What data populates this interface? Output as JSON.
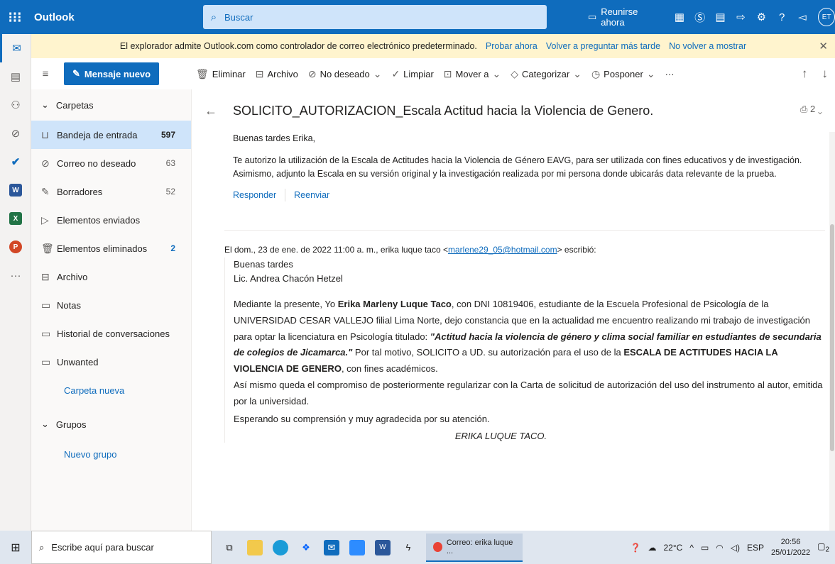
{
  "app": {
    "title": "Outlook"
  },
  "search": {
    "placeholder": "Buscar"
  },
  "topbar": {
    "meet_label": "Reunirse ahora",
    "avatar_initials": "ET"
  },
  "banner": {
    "message": "El explorador admite Outlook.com como controlador de correo electrónico predeterminado.",
    "link1": "Probar ahora",
    "link2": "Volver a preguntar más tarde",
    "link3": "No volver a mostrar"
  },
  "toolbar": {
    "new_mail": "Mensaje nuevo",
    "delete": "Eliminar",
    "archive": "Archivo",
    "junk": "No deseado",
    "sweep": "Limpiar",
    "move": "Mover a",
    "categorize": "Categorizar",
    "snooze": "Posponer",
    "more": "···"
  },
  "folders": {
    "header": "Carpetas",
    "items": [
      {
        "label": "Bandeja de entrada",
        "count": "597"
      },
      {
        "label": "Correo no deseado",
        "count": "63"
      },
      {
        "label": "Borradores",
        "count": "52"
      },
      {
        "label": "Elementos enviados",
        "count": ""
      },
      {
        "label": "Elementos eliminados",
        "count": "2"
      },
      {
        "label": "Archivo",
        "count": ""
      },
      {
        "label": "Notas",
        "count": ""
      },
      {
        "label": "Historial de conversaciones",
        "count": ""
      },
      {
        "label": "Unwanted",
        "count": ""
      }
    ],
    "new_folder": "Carpeta nueva",
    "groups_header": "Grupos",
    "new_group": "Nuevo grupo"
  },
  "message": {
    "subject": "SOLICITO_AUTORIZACION_Escala Actitud hacia la Violencia de Genero.",
    "attachments": "2",
    "greeting": "Buenas tardes Erika,",
    "body": "Te autorizo la utilización de la Escala de Actitudes hacia la Violencia de Género EAVG, para ser utilizada con fines educativos y de investigación. Asimismo, adjunto la Escala en su versión original y la investigación realizada por mi persona donde ubicarás data relevante de la prueba.",
    "reply": "Responder",
    "forward": "Reenviar"
  },
  "quoted": {
    "header_prefix": "El dom., 23 de ene. de 2022 11:00 a. m., erika luque taco <",
    "email": "marlene29_05@hotmail.com",
    "header_suffix": "> escribió:",
    "line1": "Buenas tardes",
    "line2": "Lic. Andrea Chacón Hetzel",
    "p1_a": "Mediante la presente, Yo ",
    "p1_name": "Erika Marleny Luque Taco",
    "p1_b": ", con DNI 10819406, estudiante de la Escuela Profesional de Psicología de la UNIVERSIDAD CESAR VALLEJO filial Lima Norte, dejo constancia que en la actualidad me encuentro realizando mi trabajo de investigación para optar la licenciatura en Psicología titulado: ",
    "p1_title": "\"Actitud hacia la violencia de género y clima social familiar en estudiantes de secundaria de colegios de Jicamarca.\"",
    "p1_c": " Por tal motivo, SOLICITO a UD. su autorización para el uso de la ",
    "p1_scale": "ESCALA DE ACTITUDES HACIA LA VIOLENCIA DE GENERO",
    "p1_d": ", con fines académicos.",
    "p2": "Así mismo queda el compromiso de posteriormente regularizar con la Carta de solicitud de autorización del uso del instrumento al autor, emitida por la universidad.",
    "p3": "Esperando su comprensión y muy agradecida por su atención.",
    "signature": "ERIKA LUQUE TACO."
  },
  "taskbar": {
    "search_placeholder": "Escribe aquí para buscar",
    "active_task": "Correo: erika luque ...",
    "weather": "22°C",
    "lang": "ESP",
    "time": "20:56",
    "date": "25/01/2022",
    "notif_count": "2"
  }
}
